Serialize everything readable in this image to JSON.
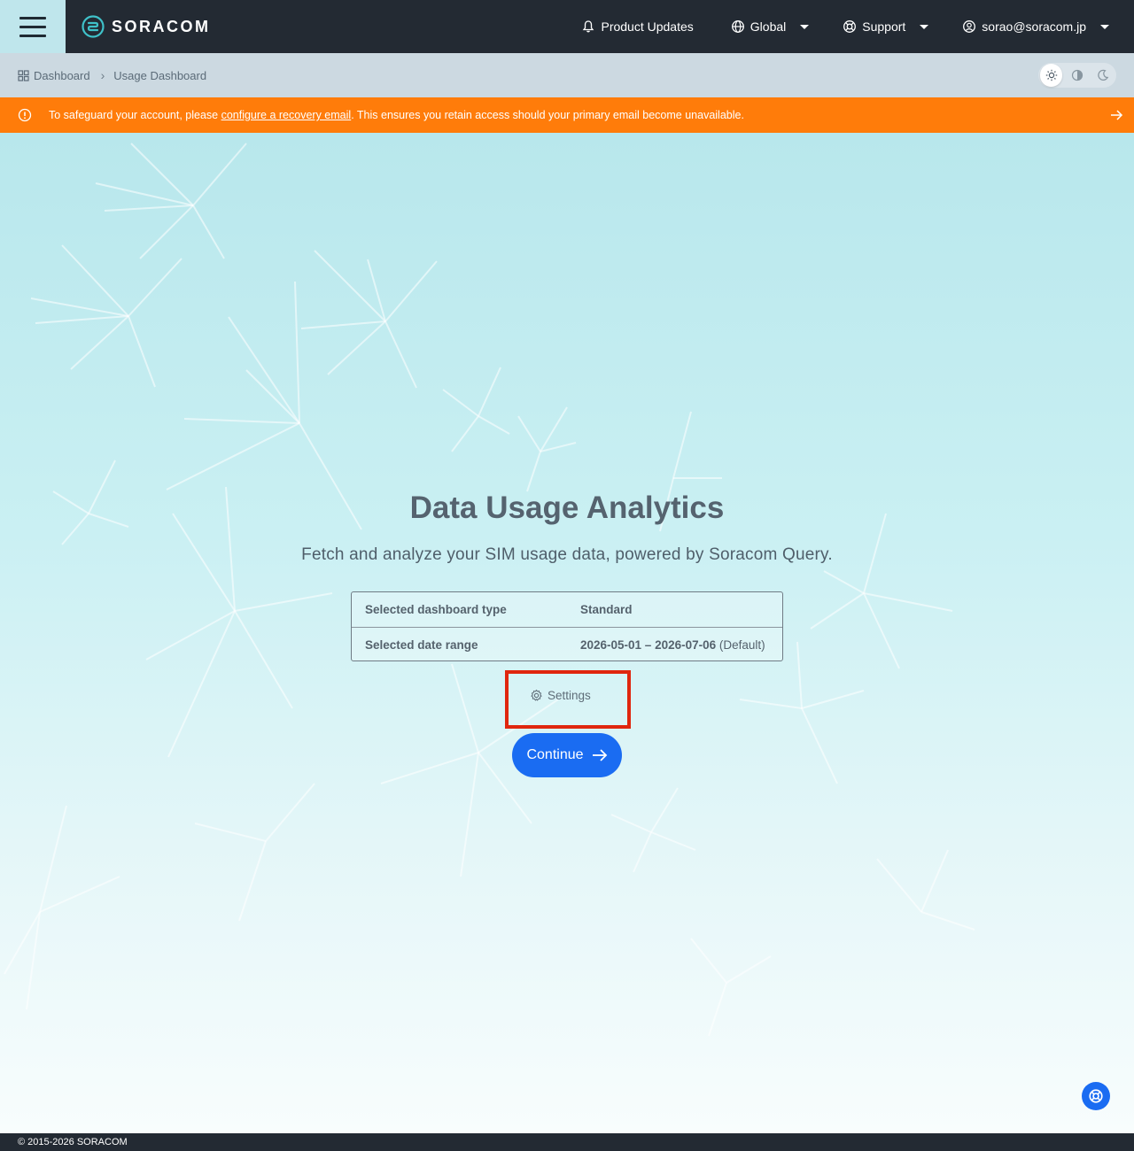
{
  "nav": {
    "brand": "SORACOM",
    "product_updates": "Product Updates",
    "region": "Global",
    "support": "Support",
    "user_email": "sorao@soracom.jp"
  },
  "breadcrumb": {
    "items": [
      {
        "label": "Dashboard"
      },
      {
        "label": "Usage Dashboard"
      }
    ]
  },
  "theme": {
    "options": [
      "light",
      "auto",
      "dark"
    ],
    "selected": "light"
  },
  "banner": {
    "text_before": "To safeguard your account, please ",
    "link_text": "configure a recovery email",
    "text_after": ". This ensures you retain access should your primary email become unavailable."
  },
  "main": {
    "title": "Data Usage Analytics",
    "subtitle": "Fetch and analyze your SIM usage data, powered by Soracom Query.",
    "summary": {
      "rows": [
        {
          "label": "Selected dashboard type",
          "value": "Standard",
          "note": ""
        },
        {
          "label": "Selected date range",
          "value": "2026-05-01 – 2026-07-06",
          "note": " (Default)"
        }
      ]
    },
    "settings_label": "Settings",
    "continue_label": "Continue"
  },
  "footer": {
    "copyright": "© 2015-2026 SORACOM"
  },
  "colors": {
    "topbar": "#232a33",
    "banner": "#ff7c0a",
    "primary": "#1a6cf2",
    "highlight": "#e0260e"
  }
}
